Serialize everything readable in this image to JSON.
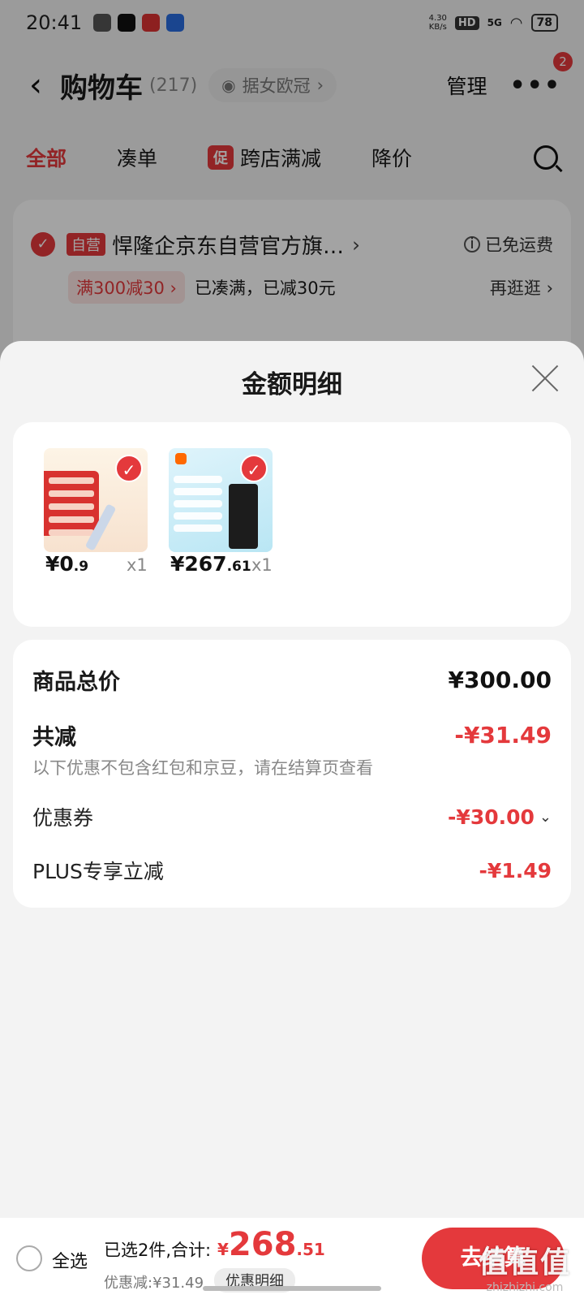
{
  "status_bar": {
    "time": "20:41",
    "net_speed": "4.30\nKB/s",
    "hd": "HD",
    "signal": "5G",
    "battery": "78"
  },
  "header": {
    "title": "购物车",
    "count": "(217)",
    "address": "据女欧冠",
    "manage": "管理",
    "more_badge": "2"
  },
  "tabs": [
    "全部",
    "凑单",
    "跨店满减",
    "降价"
  ],
  "promo_tag": "促",
  "store": {
    "tag": "自营",
    "name": "悍隆企京东自营官方旗…",
    "free_shipping": "已免运费",
    "promo_chip": "满300减30 ›",
    "promo_text": "已凑满，已减30元",
    "browse": "再逛逛 ›"
  },
  "sheet": {
    "title": "金额明细",
    "goods": [
      {
        "price_int": "¥0",
        "price_dec": ".9",
        "qty": "x1"
      },
      {
        "price_int": "¥267",
        "price_dec": ".61",
        "qty": "x1"
      }
    ],
    "rows": {
      "total_label": "商品总价",
      "total_value": "¥300.00",
      "discount_label": "共减",
      "discount_value": "-¥31.49",
      "note": "以下优惠不包含红包和京豆，请在结算页查看",
      "coupon_label": "优惠券",
      "coupon_value": "-¥30.00",
      "plus_label": "PLUS专享立减",
      "plus_value": "-¥1.49"
    }
  },
  "bottom": {
    "select_all": "全选",
    "selected": "已选2件,合计:",
    "total_cur": "¥",
    "total_int": "268",
    "total_dec": ".51",
    "discount": "优惠减:¥31.49",
    "detail_button": "优惠明细",
    "checkout": "去结算",
    "watermark": "值值值",
    "watermark_url": "zhizhizhi.com"
  },
  "colors": {
    "accent": "#e4393c"
  }
}
